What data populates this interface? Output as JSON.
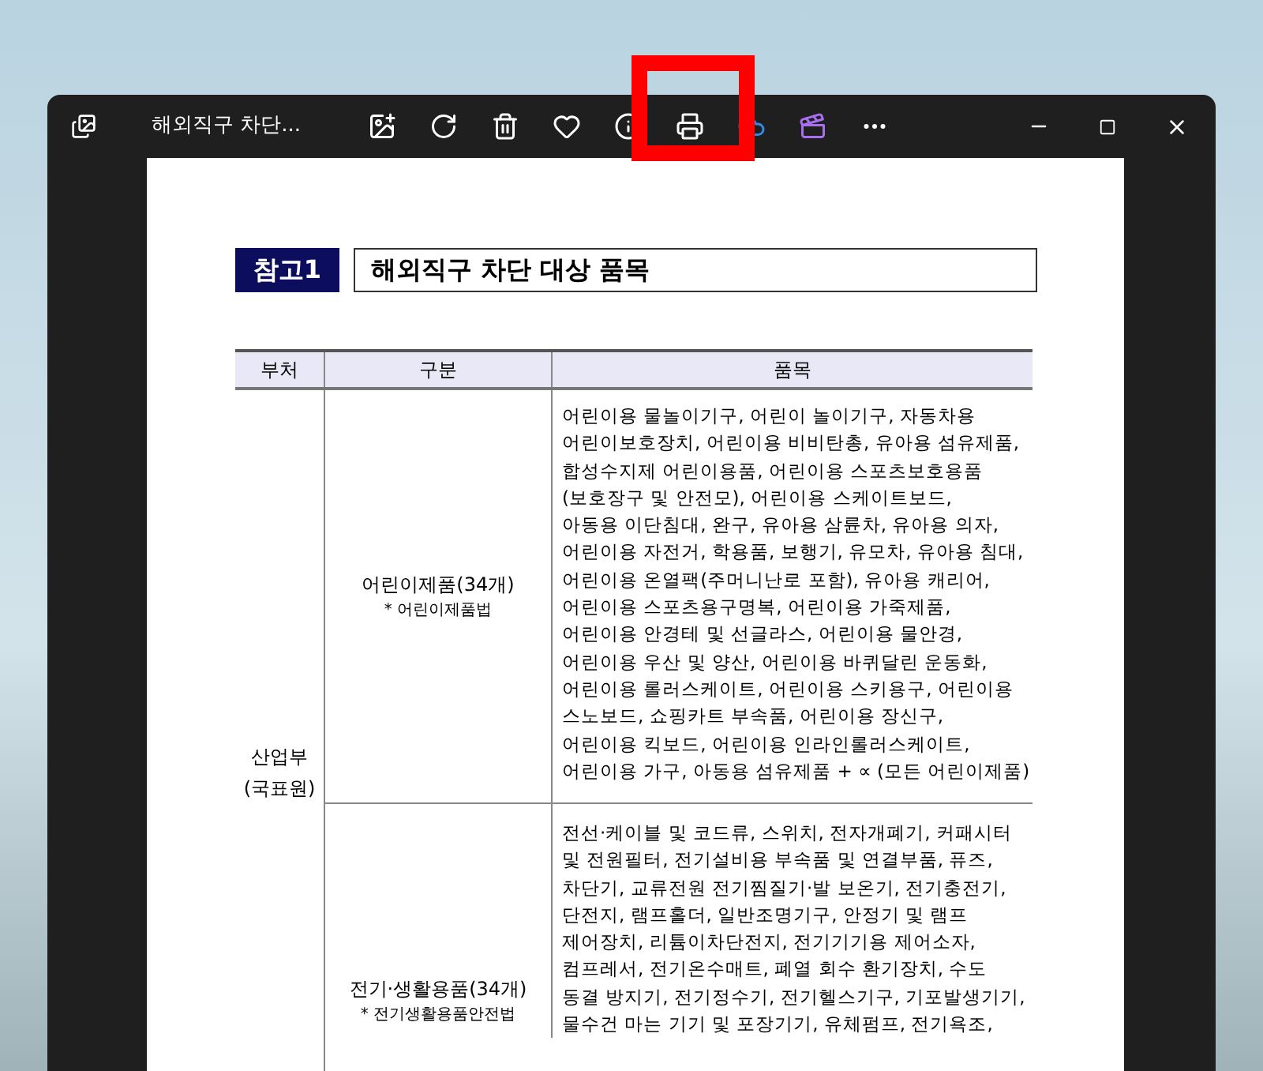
{
  "window": {
    "title": "해외직구 차단..."
  },
  "document": {
    "badge": "참고1",
    "title": "해외직구 차단 대상 품목",
    "table": {
      "columns": [
        "부처",
        "구분",
        "품목"
      ],
      "ministry": [
        "산업부",
        "(국표원)"
      ],
      "rows": [
        {
          "category": "어린이제품(34개)",
          "law": "* 어린이제품법",
          "items": [
            "어린이용 물놀이기구, 어린이 놀이기구, 자동차용",
            "어린이보호장치, 어린이용 비비탄총, 유아용 섬유제품,",
            "합성수지제 어린이용품, 어린이용 스포츠보호용품",
            "(보호장구 및 안전모), 어린이용 스케이트보드,",
            "아동용 이단침대, 완구, 유아용 삼륜차, 유아용 의자,",
            "어린이용 자전거, 학용품, 보행기, 유모차, 유아용 침대,",
            "어린이용 온열팩(주머니난로 포함), 유아용 캐리어,",
            "어린이용 스포츠용구명복, 어린이용 가죽제품,",
            "어린이용 안경테 및 선글라스, 어린이용 물안경,",
            "어린이용 우산 및 양산, 어린이용 바퀴달린 운동화,",
            "어린이용 롤러스케이트, 어린이용 스키용구, 어린이용",
            "스노보드, 쇼핑카트 부속품, 어린이용 장신구,",
            "어린이용 킥보드, 어린이용 인라인롤러스케이트,",
            "어린이용 가구, 아동용 섬유제품 + ∝ (모든 어린이제품)"
          ]
        },
        {
          "category": "전기·생활용품(34개)",
          "law": "* 전기생활용품안전법",
          "items": [
            "전선·케이블 및 코드류, 스위치, 전자개폐기, 커패시터",
            "및 전원필터, 전기설비용 부속품 및 연결부품, 퓨즈,",
            "차단기, 교류전원 전기찜질기·발 보온기, 전기충전기,",
            "단전지, 램프홀더, 일반조명기구, 안정기 및 램프",
            "제어장치, 리튬이차단전지, 전기기기용 제어소자,",
            "컴프레서, 전기온수매트, 폐열 회수 환기장치, 수도",
            "동결 방지기, 전기정수기, 전기헬스기구, 기포발생기기,",
            "물수건 마는 기기 및 포장기기, 유체펌프, 전기욕조,"
          ]
        }
      ]
    }
  }
}
